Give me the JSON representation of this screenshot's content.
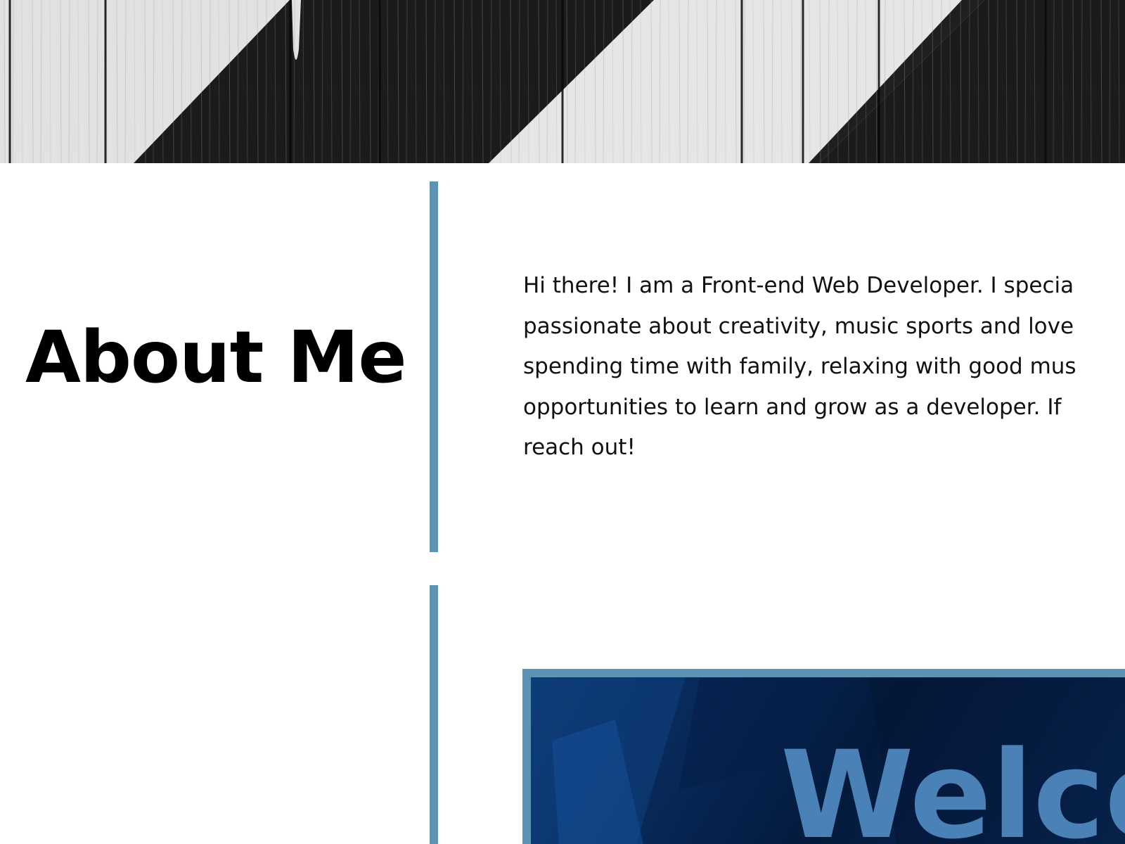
{
  "about": {
    "heading": "About Me",
    "paragraph_lines": [
      "Hi there! I am a Front-end Web Developer. I specia",
      "passionate about creativity, music sports and love",
      "spending time with family, relaxing with good mus",
      "opportunities to learn and grow as a developer. If",
      "reach out!"
    ]
  },
  "preview": {
    "text": "Welco"
  },
  "colors": {
    "accent": "#5b93b4",
    "hero_dark": "#1b1b1d",
    "hero_light": "#e4e4e6",
    "welcome_text": "#4a82b8",
    "preview_background": "#062450"
  }
}
